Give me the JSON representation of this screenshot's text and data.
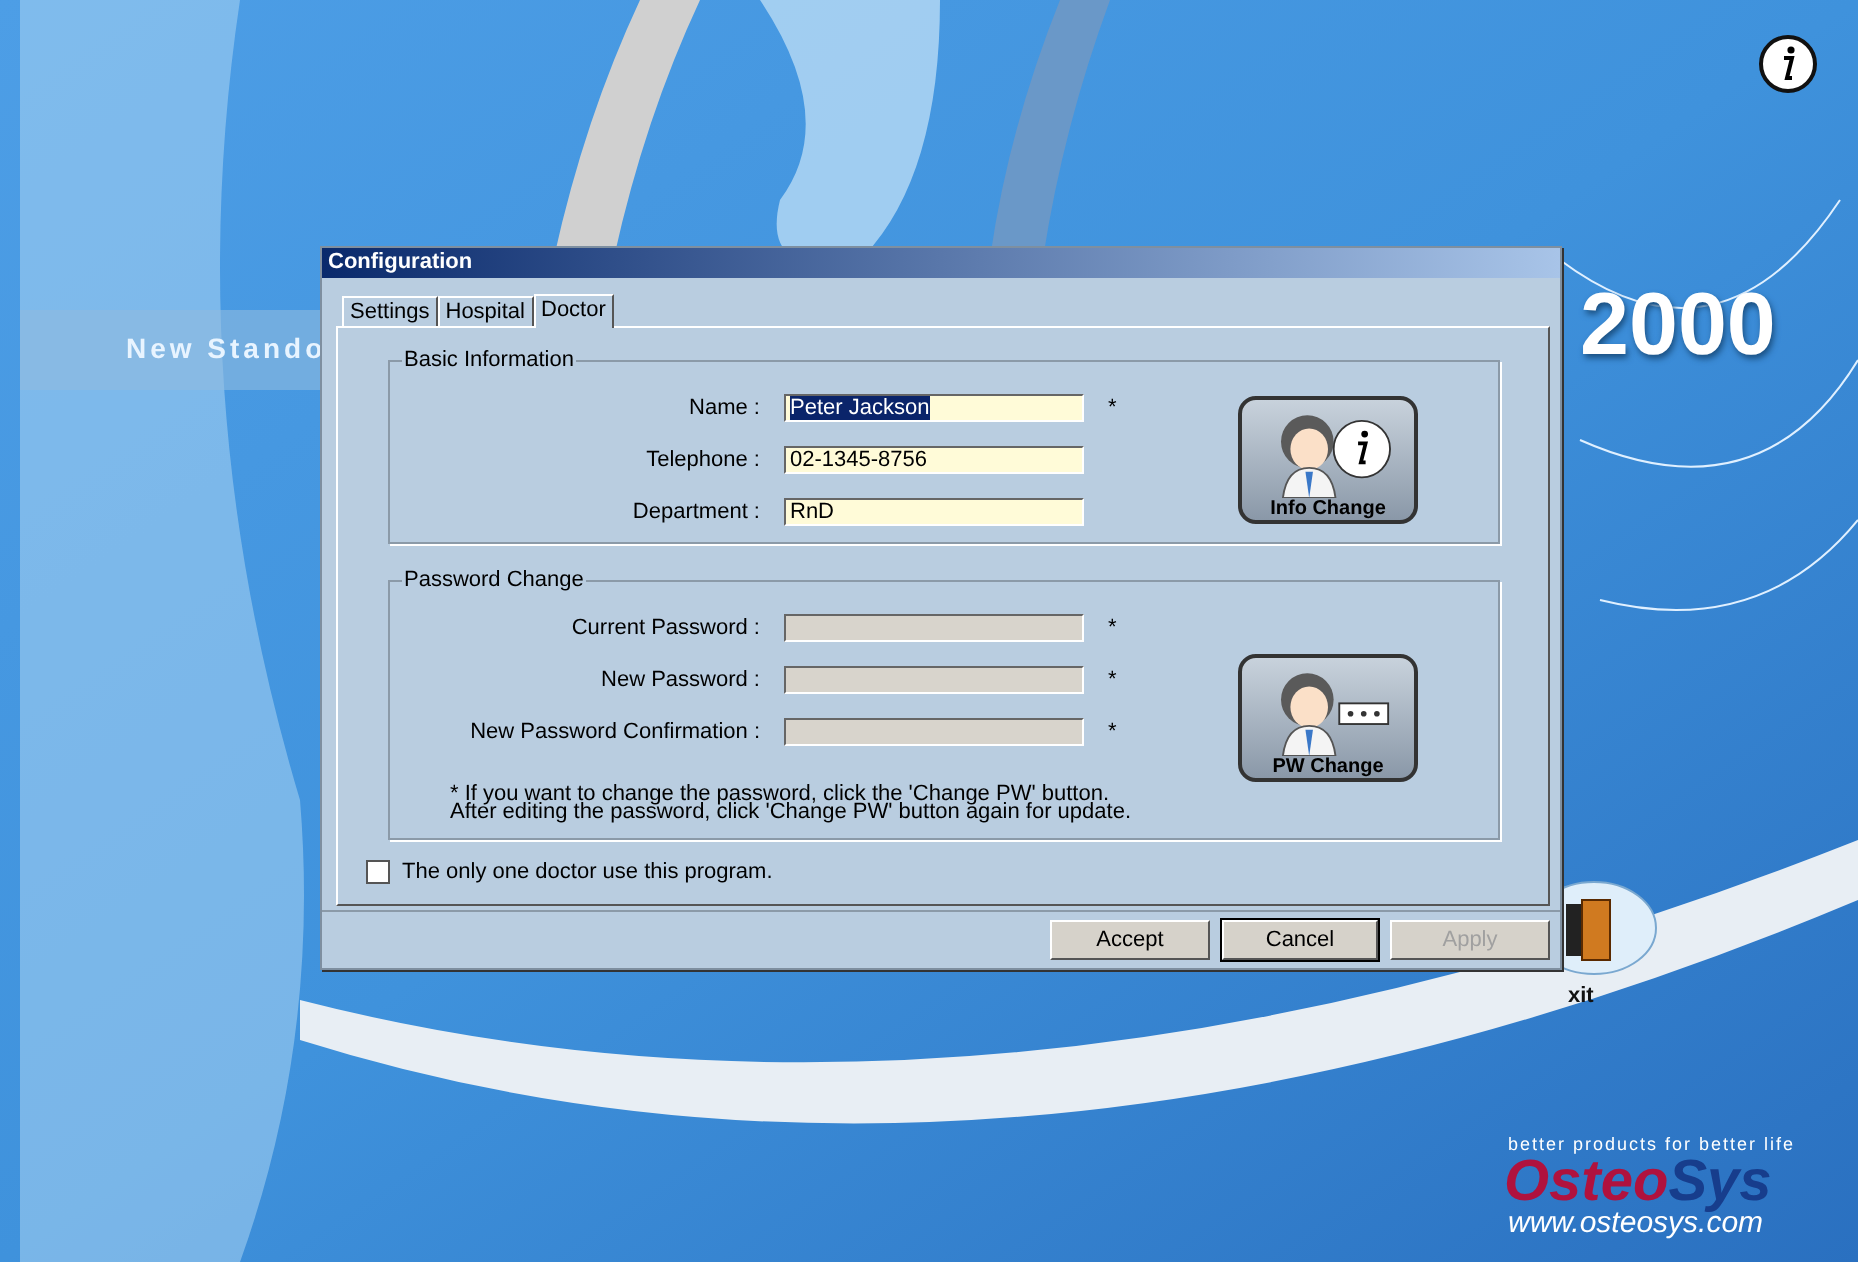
{
  "background": {
    "tagline": "New Stando",
    "version": "2000",
    "exit_label": "xit",
    "brand": {
      "slogan": "better products for better life",
      "name_part_1": "Osteo",
      "name_part_2": "Sys",
      "url": "www.osteosys.com"
    }
  },
  "dialog": {
    "title": "Configuration",
    "tabs": [
      {
        "label": "Settings",
        "selected": false
      },
      {
        "label": "Hospital",
        "selected": false
      },
      {
        "label": "Doctor",
        "selected": true
      }
    ],
    "basic_information": {
      "legend": "Basic Information",
      "fields": [
        {
          "label": "Name :",
          "value": "Peter Jackson",
          "required_mark": "*",
          "selected": true,
          "disabled": false
        },
        {
          "label": "Telephone :",
          "value": "02-1345-8756",
          "selected": false,
          "disabled": false
        },
        {
          "label": "Department :",
          "value": "RnD",
          "selected": false,
          "disabled": false
        }
      ],
      "button": "Info Change"
    },
    "password_change": {
      "legend": "Password Change",
      "fields": [
        {
          "label": "Current Password :",
          "required_mark": "*",
          "disabled": true
        },
        {
          "label": "New Password :",
          "required_mark": "*",
          "disabled": true
        },
        {
          "label": "New Password Confirmation :",
          "required_mark": "*",
          "disabled": true
        }
      ],
      "button": "PW Change",
      "note_lines": [
        "* If you want to change the password, click the 'Change PW' button.",
        "After editing the password, click 'Change PW' button again for update."
      ]
    },
    "checkbox": {
      "label": "The only one doctor use this program.",
      "checked": false
    },
    "buttons": [
      {
        "label": "Accept",
        "disabled": false,
        "default": false
      },
      {
        "label": "Cancel",
        "disabled": false,
        "default": true
      },
      {
        "label": "Apply",
        "disabled": true,
        "default": false
      }
    ]
  }
}
